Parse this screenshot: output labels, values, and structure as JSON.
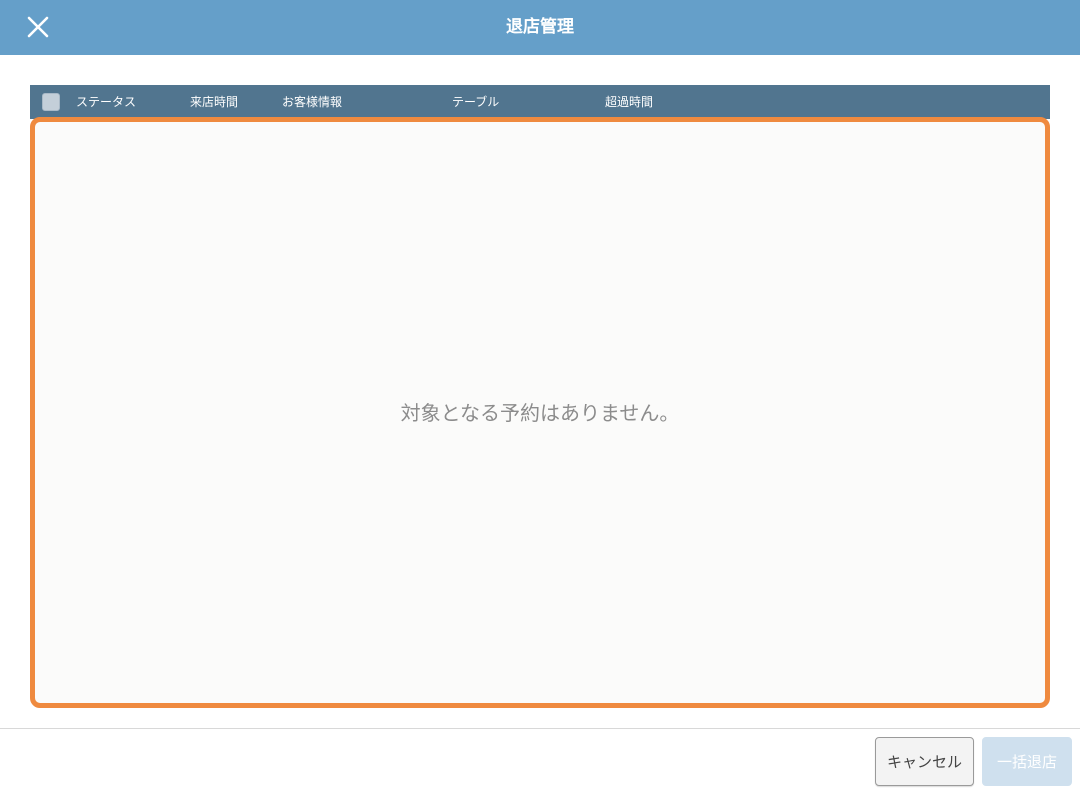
{
  "header": {
    "title": "退店管理",
    "close_icon": "close-icon",
    "background": "#659fc9"
  },
  "table": {
    "select_all_checked": false,
    "columns": [
      "ステータス",
      "来店時間",
      "お客様情報",
      "テーブル",
      "超過時間"
    ],
    "header_background": "#51758f"
  },
  "empty_state": {
    "message": "対象となる予約はありません。",
    "highlight_color": "#ef8a3f"
  },
  "footer": {
    "cancel_label": "キャンセル",
    "bulk_checkout_label": "一括退店",
    "bulk_checkout_enabled": false
  }
}
